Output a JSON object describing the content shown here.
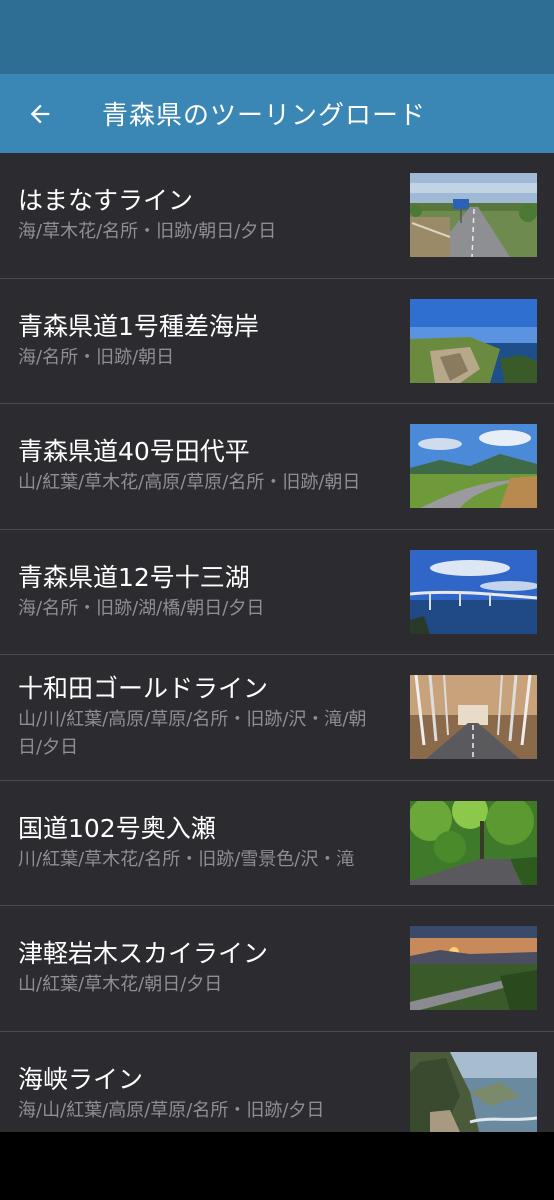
{
  "app_bar": {
    "title": "青森県のツーリングロード"
  },
  "routes": [
    {
      "title": "はまなすライン",
      "tags": "海/草木花/名所・旧跡/朝日/夕日",
      "image": "straight-road-with-sign-photo"
    },
    {
      "title": "青森県道1号種差海岸",
      "tags": "海/名所・旧跡/朝日",
      "image": "rocky-coast-photo"
    },
    {
      "title": "青森県道40号田代平",
      "tags": "山/紅葉/草木花/高原/草原/名所・旧跡/朝日",
      "image": "highland-road-photo"
    },
    {
      "title": "青森県道12号十三湖",
      "tags": "海/名所・旧跡/湖/橋/朝日/夕日",
      "image": "lake-bridge-photo"
    },
    {
      "title": "十和田ゴールドライン",
      "tags": "山/川/紅葉/高原/草原/名所・旧跡/沢・滝/朝日/夕日",
      "image": "tree-tunnel-road-photo"
    },
    {
      "title": "国道102号奥入瀬",
      "tags": "川/紅葉/草木花/名所・旧跡/雪景色/沢・滝",
      "image": "forest-road-photo"
    },
    {
      "title": "津軽岩木スカイライン",
      "tags": "山/紅葉/草木花/朝日/夕日",
      "image": "sunset-mountain-road-photo"
    },
    {
      "title": "海峡ライン",
      "tags": "海/山/紅葉/高原/草原/名所・旧跡/夕日",
      "image": "cliff-coast-photo"
    }
  ]
}
